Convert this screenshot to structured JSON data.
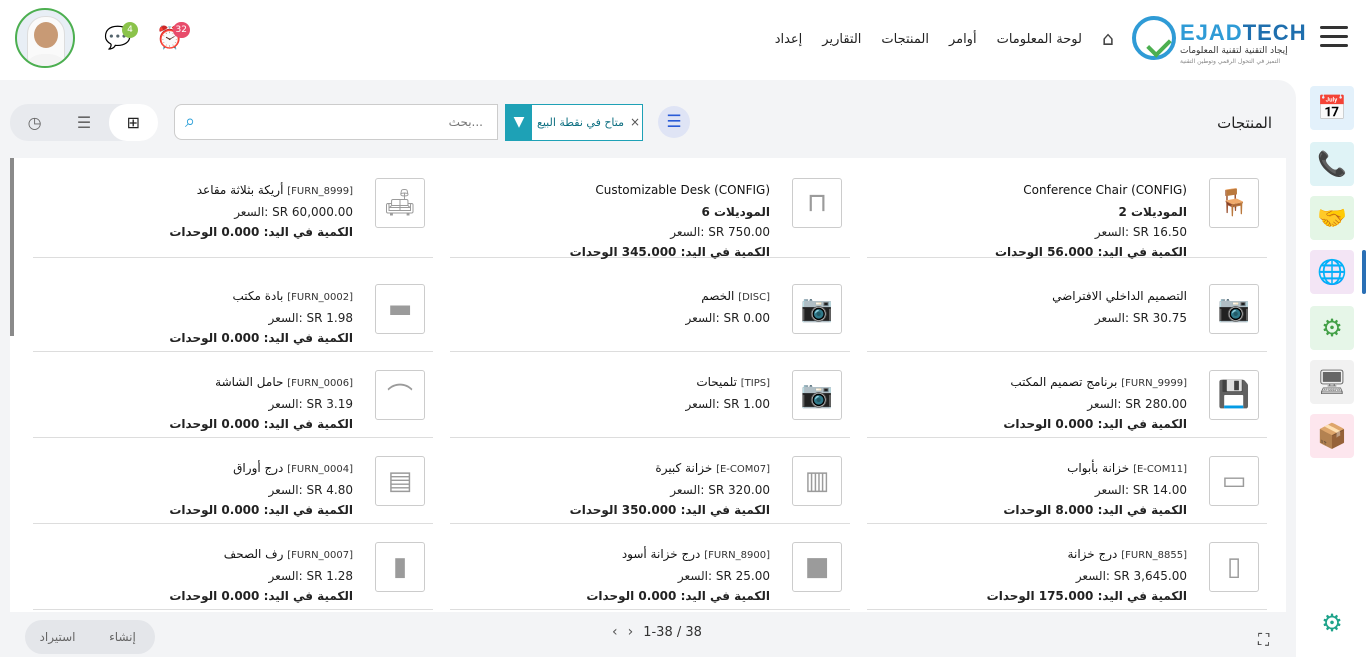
{
  "header": {
    "logo_brand_a": "EJAD",
    "logo_brand_b": "TECH",
    "logo_tagline": "إيجاد التقنية لتقنية المعلومات",
    "logo_subtagline": "التميز في التحول الرقمي وتوطين التقنية",
    "nav": [
      "لوحة المعلومات",
      "أوامر",
      "المنتجات",
      "التقارير",
      "إعداد"
    ],
    "messages_count": "4",
    "activities_count": "32",
    "messages_badge_color": "#8bc34a",
    "activities_badge_color": "#e84c6b"
  },
  "control_panel": {
    "title": "المنتجات",
    "facet_label": "متاح في نقطة البيع",
    "facet_remove": "×",
    "search_placeholder": "بحث..."
  },
  "products": [
    {
      "name": "Conference Chair (CONFIG)",
      "code": "",
      "variants": "2 الموديلات",
      "price": "السعر: SR 16.50",
      "qty": "الكمية في اليد: 56.000 الوحدات",
      "image": "chair"
    },
    {
      "name": "Customizable Desk (CONFIG)",
      "code": "",
      "variants": "6 الموديلات",
      "price": "السعر: SR 750.00",
      "qty": "الكمية في اليد: 345.000 الوحدات",
      "image": "desk"
    },
    {
      "name": "أريكة بثلاثة مقاعد",
      "code": "[FURN_8999]",
      "variants": "",
      "price": "السعر: SR 60,000.00",
      "qty": "الكمية في اليد: 0.000 الوحدات",
      "image": "sofa"
    },
    {
      "name": "التصميم الداخلي الافتراضي",
      "code": "",
      "variants": "",
      "price": "السعر: SR 30.75",
      "qty": "",
      "image": "placeholder"
    },
    {
      "name": "الخصم",
      "code": "[DISC]",
      "variants": "",
      "price": "السعر: SR 0.00",
      "qty": "",
      "image": "placeholder"
    },
    {
      "name": "بادة مكتب",
      "code": "[FURN_0002]",
      "variants": "",
      "price": "السعر: SR 1.98",
      "qty": "الكمية في اليد: 0.000 الوحدات",
      "image": "pad"
    },
    {
      "name": "برنامج تصميم المكتب",
      "code": "[FURN_9999]",
      "variants": "",
      "price": "السعر: SR 280.00",
      "qty": "الكمية في اليد: 0.000 الوحدات",
      "image": "software"
    },
    {
      "name": "تلميحات",
      "code": "[TIPS]",
      "variants": "",
      "price": "السعر: SR 1.00",
      "qty": "",
      "image": "placeholder"
    },
    {
      "name": "حامل الشاشة",
      "code": "[FURN_0006]",
      "variants": "",
      "price": "السعر: SR 3.19",
      "qty": "الكمية في اليد: 0.000 الوحدات",
      "image": "stand"
    },
    {
      "name": "خزانة بأبواب",
      "code": "[E-COM11]",
      "variants": "",
      "price": "السعر: SR 14.00",
      "qty": "الكمية في اليد: 8.000 الوحدات",
      "image": "cabinet"
    },
    {
      "name": "خزانة كبيرة",
      "code": "[E-COM07]",
      "variants": "",
      "price": "السعر: SR 320.00",
      "qty": "الكمية في اليد: 350.000 الوحدات",
      "image": "bigcabinet"
    },
    {
      "name": "درج أوراق",
      "code": "[FURN_0004]",
      "variants": "",
      "price": "السعر: SR 4.80",
      "qty": "الكمية في اليد: 0.000 الوحدات",
      "image": "tray"
    },
    {
      "name": "درج خزانة",
      "code": "[FURN_8855]",
      "variants": "",
      "price": "السعر: SR 3,645.00",
      "qty": "الكمية في اليد: 175.000 الوحدات",
      "image": "drawer"
    },
    {
      "name": "درج خزانة أسود",
      "code": "[FURN_8900]",
      "variants": "",
      "price": "السعر: SR 25.00",
      "qty": "الكمية في اليد: 0.000 الوحدات",
      "image": "blackdrawer"
    },
    {
      "name": "رف الصحف",
      "code": "[FURN_0007]",
      "variants": "",
      "price": "السعر: SR 1.28",
      "qty": "الكمية في اليد: 0.000 الوحدات",
      "image": "rack"
    }
  ],
  "footer": {
    "pager": "1-38 / 38",
    "create_label": "إنشاء",
    "import_label": "استيراد"
  },
  "sidebar_apps": [
    "calendar-icon",
    "contacts-icon",
    "crm-icon",
    "website-icon",
    "settings-gears-icon",
    "pos-icon",
    "inventory-icon"
  ],
  "colors": {
    "accent": "#1ea1b6",
    "brand": "#2f9bd6",
    "active_indicator": "#2a6fb5"
  }
}
